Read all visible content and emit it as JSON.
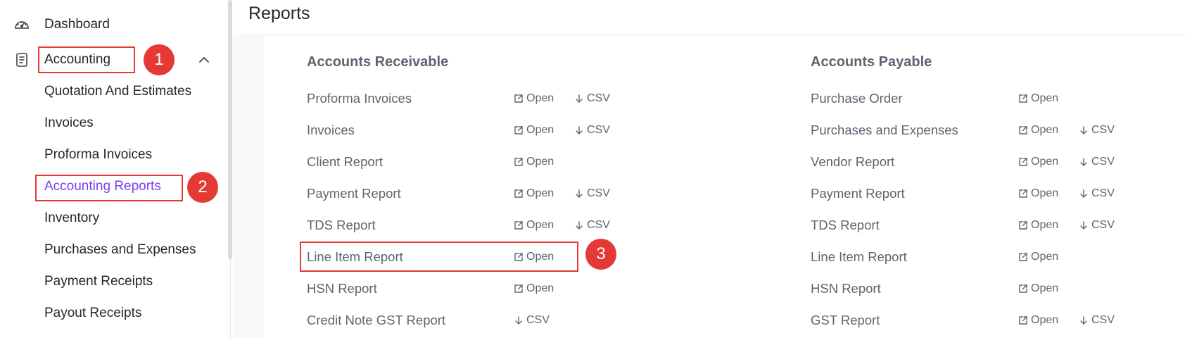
{
  "sidebar": {
    "items": [
      {
        "label": "Dashboard",
        "icon": "dashboard-gauge-icon"
      },
      {
        "label": "Accounting",
        "icon": "document-list-icon"
      },
      {
        "label": "Quotation And Estimates"
      },
      {
        "label": "Invoices"
      },
      {
        "label": "Proforma Invoices"
      },
      {
        "label": "Accounting Reports"
      },
      {
        "label": "Inventory"
      },
      {
        "label": "Purchases and Expenses"
      },
      {
        "label": "Payment Receipts"
      },
      {
        "label": "Payout Receipts"
      }
    ],
    "active_color": "#7a3ff0"
  },
  "annotations": {
    "badge1": "1",
    "badge2": "2",
    "badge3": "3",
    "color": "#e53935"
  },
  "header": {
    "title": "Reports"
  },
  "receivable": {
    "title": "Accounts Receivable",
    "rows": [
      {
        "name": "Proforma Invoices",
        "open": "Open",
        "csv": "CSV"
      },
      {
        "name": "Invoices",
        "open": "Open",
        "csv": "CSV"
      },
      {
        "name": "Client Report",
        "open": "Open"
      },
      {
        "name": "Payment Report",
        "open": "Open",
        "csv": "CSV"
      },
      {
        "name": "TDS Report",
        "open": "Open",
        "csv": "CSV"
      },
      {
        "name": "Line Item Report",
        "open": "Open"
      },
      {
        "name": "HSN Report",
        "open": "Open"
      },
      {
        "name": "Credit Note GST Report",
        "csv": "CSV"
      }
    ]
  },
  "payable": {
    "title": "Accounts Payable",
    "rows": [
      {
        "name": "Purchase Order",
        "open": "Open"
      },
      {
        "name": "Purchases and Expenses",
        "open": "Open",
        "csv": "CSV"
      },
      {
        "name": "Vendor Report",
        "open": "Open",
        "csv": "CSV"
      },
      {
        "name": "Payment Report",
        "open": "Open",
        "csv": "CSV"
      },
      {
        "name": "TDS Report",
        "open": "Open",
        "csv": "CSV"
      },
      {
        "name": "Line Item Report",
        "open": "Open"
      },
      {
        "name": "HSN Report",
        "open": "Open"
      },
      {
        "name": "GST Report",
        "open": "Open",
        "csv": "CSV"
      }
    ]
  }
}
